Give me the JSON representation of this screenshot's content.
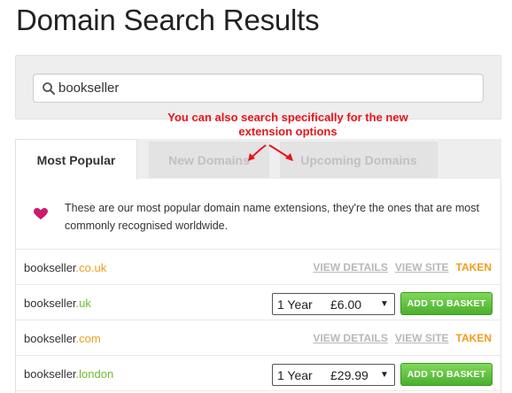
{
  "page": {
    "title": "Domain Search Results"
  },
  "search": {
    "value": "bookseller"
  },
  "annotation": {
    "text": "You can also search specifically for the new extension options"
  },
  "tabs": [
    {
      "label": "Most Popular",
      "active": true
    },
    {
      "label": "New Domains",
      "active": false
    },
    {
      "label": "Upcoming Domains",
      "active": false
    }
  ],
  "info": {
    "text": "These are our most popular domain name extensions, they're the ones that are most commonly recognised worldwide."
  },
  "results": [
    {
      "name": "bookseller",
      "ext": ".co.uk",
      "status": "taken",
      "view_details": "VIEW DETAILS",
      "view_site": "VIEW SITE",
      "taken_label": "TAKEN"
    },
    {
      "name": "bookseller",
      "ext": ".uk",
      "status": "available",
      "term": "1 Year",
      "price": "£6.00",
      "add_label": "ADD TO BASKET"
    },
    {
      "name": "bookseller",
      "ext": ".com",
      "status": "taken",
      "view_details": "VIEW DETAILS",
      "view_site": "VIEW SITE",
      "taken_label": "TAKEN"
    },
    {
      "name": "bookseller",
      "ext": ".london",
      "status": "available",
      "term": "1 Year",
      "price": "£29.99",
      "add_label": "ADD TO BASKET"
    }
  ],
  "colors": {
    "taken_ext": "#f39c1e",
    "available_ext": "#6cbf2e",
    "annotation": "#e8141b",
    "button": "#5bbf37",
    "heart": "#cc1a6e"
  }
}
